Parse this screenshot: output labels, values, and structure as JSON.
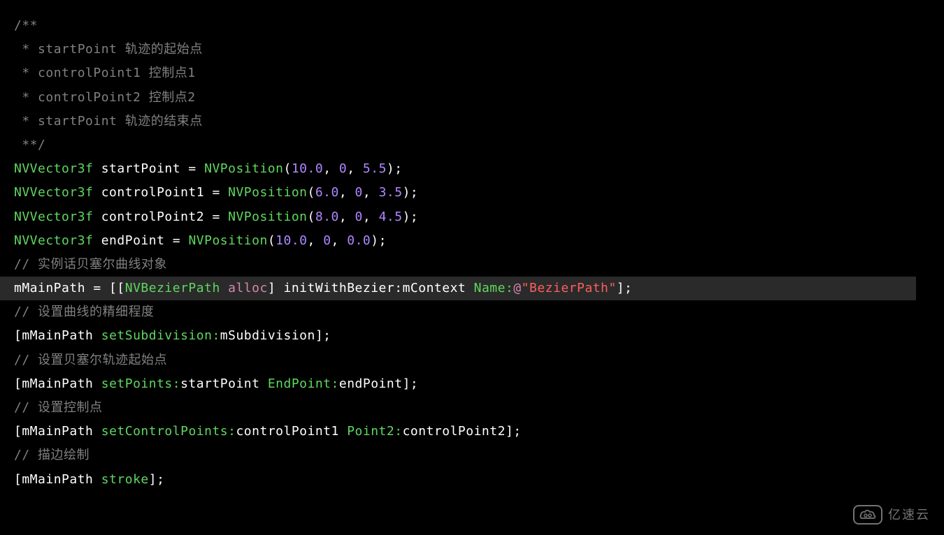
{
  "code": {
    "comment_block": {
      "open": "/**",
      "line1_prefix": " * ",
      "line1_text": "startPoint 轨迹的起始点",
      "line2_prefix": " * ",
      "line2_text": "controlPoint1 控制点1",
      "line3_prefix": " * ",
      "line3_text": "controlPoint2 控制点2",
      "line4_prefix": " * ",
      "line4_text": "startPoint 轨迹的结束点",
      "close": " **/"
    },
    "decl1": {
      "type": "NVVector3f",
      "name": "startPoint",
      "func": "NVPosition",
      "args": [
        "10.0",
        "0",
        "5.5"
      ]
    },
    "decl2": {
      "type": "NVVector3f",
      "name": "controlPoint1",
      "func": "NVPosition",
      "args": [
        "6.0",
        "0",
        "3.5"
      ]
    },
    "decl3": {
      "type": "NVVector3f",
      "name": "controlPoint2",
      "func": "NVPosition",
      "args": [
        "8.0",
        "0",
        "4.5"
      ]
    },
    "decl4": {
      "type": "NVVector3f",
      "name": "endPoint",
      "func": "NVPosition",
      "args": [
        "10.0",
        "0",
        "0.0"
      ]
    },
    "comment5": "// 实例话贝塞尔曲线对象",
    "main_assign": {
      "lhs": "mMainPath",
      "class": "NVBezierPath",
      "alloc": "alloc",
      "init_method": "initWithBezier:",
      "init_arg": "mContext",
      "name_label": "Name:",
      "at": "@",
      "string_val": "\"BezierPath\""
    },
    "comment6": "// 设置曲线的精细程度",
    "call1": {
      "receiver": "mMainPath",
      "method": "setSubdivision:",
      "arg": "mSubdivision"
    },
    "comment7": "// 设置贝塞尔轨迹起始点",
    "call2": {
      "receiver": "mMainPath",
      "method": "setPoints:",
      "arg1": "startPoint",
      "label2": "EndPoint:",
      "arg2": "endPoint"
    },
    "comment8": "// 设置控制点",
    "call3": {
      "receiver": "mMainPath",
      "method": "setControlPoints:",
      "arg1": "controlPoint1",
      "label2": "Point2:",
      "arg2": "controlPoint2"
    },
    "comment9": "// 描边绘制",
    "call4": {
      "receiver": "mMainPath",
      "method": "stroke"
    }
  },
  "watermark": {
    "text": "亿速云",
    "icon_text": "∞"
  }
}
